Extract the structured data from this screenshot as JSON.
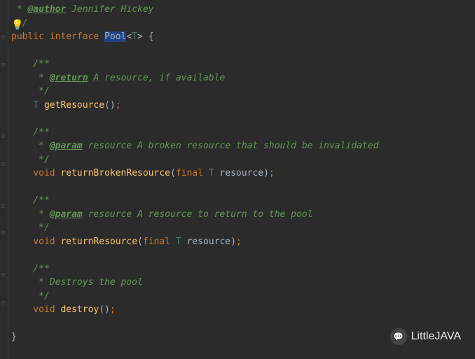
{
  "code": {
    "line1_prefix": " * ",
    "line1_tag": "@author",
    "line1_text": " Jennifer Hickey",
    "line2": " */",
    "line3_kw1": "public",
    "line3_kw2": "interface",
    "line3_class": "Pool",
    "line3_tp": "T",
    "line3_brace": " {",
    "line4": "",
    "line5": "    /**",
    "line6_prefix": "     * ",
    "line6_tag": "@return",
    "line6_text": " A resource, if available",
    "line7": "     */",
    "line8_indent": "    ",
    "line8_type": "T ",
    "line8_method": "getResource",
    "line8_end": "();",
    "line9": "",
    "line10": "    /**",
    "line11_prefix": "     * ",
    "line11_tag": "@param",
    "line11_text": " resource A broken resource that should be invalidated",
    "line12": "     */",
    "line13_indent": "    ",
    "line13_kw": "void ",
    "line13_method": "returnBrokenResource",
    "line13_p1": "(",
    "line13_kw2": "final ",
    "line13_type": "T ",
    "line13_param": "resource",
    "line13_end": ");",
    "line14": "",
    "line15": "    /**",
    "line16_prefix": "     * ",
    "line16_tag": "@param",
    "line16_text": " resource A resource to return to the pool",
    "line17": "     */",
    "line18_indent": "    ",
    "line18_kw": "void ",
    "line18_method": "returnResource",
    "line18_p1": "(",
    "line18_kw2": "final ",
    "line18_type": "T ",
    "line18_param": "resource",
    "line18_end": ");",
    "line19": "",
    "line20": "    /**",
    "line21": "     * Destroys the pool",
    "line22": "     */",
    "line23_indent": "    ",
    "line23_kw": "void ",
    "line23_method": "destroy",
    "line23_end": "();",
    "line24": "",
    "line25": "}"
  },
  "watermark": "LittleJAVA",
  "bulb": "💡"
}
